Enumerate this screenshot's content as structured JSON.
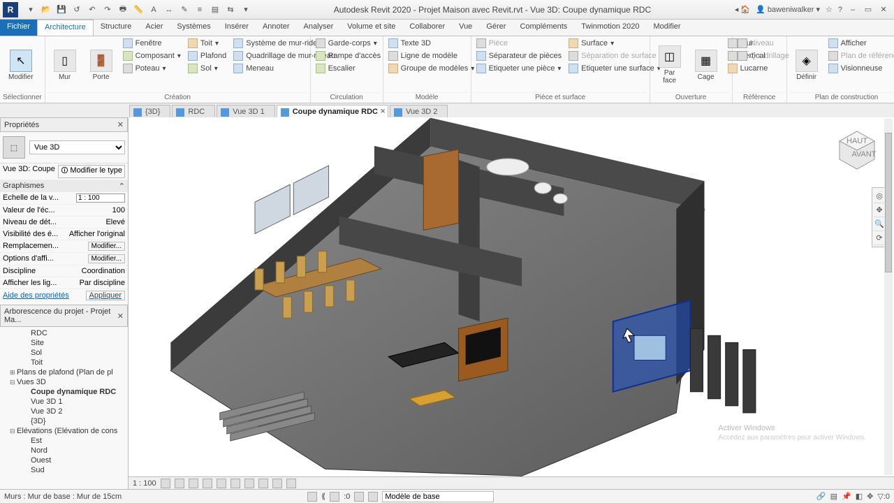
{
  "titlebar": {
    "app_title": "Autodesk Revit 2020 - Projet Maison avec Revit.rvt - Vue 3D: Coupe dynamique RDC",
    "user": "baweniwalker"
  },
  "menu": {
    "file": "Fichier",
    "tabs": [
      "Architecture",
      "Structure",
      "Acier",
      "Systèmes",
      "Insérer",
      "Annoter",
      "Analyser",
      "Volume et site",
      "Collaborer",
      "Vue",
      "Gérer",
      "Compléments",
      "Twinmotion 2020",
      "Modifier"
    ],
    "active": 0
  },
  "ribbon": {
    "modify": "Modifier",
    "select_label": "Sélectionner",
    "wall": "Mur",
    "door": "Porte",
    "window": "Fenêtre",
    "component": "Composant",
    "column": "Poteau",
    "roof": "Toit",
    "ceiling": "Plafond",
    "floor": "Sol",
    "curtain_system": "Système de mur-rideau",
    "curtain_grid": "Quadrillage de mur-rideau",
    "mullion": "Meneau",
    "create_label": "Création",
    "railing": "Garde-corps",
    "ramp": "Rampe d'accès",
    "stair": "Escalier",
    "circulation_label": "Circulation",
    "text3d": "Texte 3D",
    "model_line": "Ligne de modèle",
    "model_group": "Groupe de modèles",
    "model_label": "Modèle",
    "room": "Pièce",
    "room_sep": "Séparateur  de pièces",
    "room_tag": "Etiqueter  une pièce",
    "surface": "Surface",
    "surface_sep": "Séparation de surface",
    "surface_tag": "Etiqueter  une surface",
    "room_label": "Pièce et surface",
    "by_face": "Par face",
    "shaft": "Cage",
    "wall_op": "Mur",
    "vertical": "Vertical",
    "dormer": "Lucarne",
    "opening_label": "Ouverture",
    "level": "Niveau",
    "grid": "Quadrillage",
    "ref_label": "Référence",
    "define": "Définir",
    "show": "Afficher",
    "ref_plane": "Plan de référence",
    "viewer": "Visionneuse",
    "workplane_label": "Plan de construction"
  },
  "viewtabs": [
    {
      "label": "{3D}",
      "active": false
    },
    {
      "label": "RDC",
      "active": false
    },
    {
      "label": "Vue 3D 1",
      "active": false
    },
    {
      "label": "Coupe dynamique RDC",
      "active": true
    },
    {
      "label": "Vue 3D 2",
      "active": false
    }
  ],
  "properties": {
    "title": "Propriétés",
    "type": "Vue 3D",
    "instance": "Vue 3D: Coupe",
    "edit_type": "Modifier le type",
    "cat": "Graphismes",
    "rows": [
      {
        "k": "Echelle de la v...",
        "v": "1 : 100",
        "input": true
      },
      {
        "k": "Valeur de l'éc...",
        "v": "100"
      },
      {
        "k": "Niveau de dét...",
        "v": "Elevé"
      },
      {
        "k": "Visibilité des é...",
        "v": "Afficher l'original"
      },
      {
        "k": "Remplacemen...",
        "v": "Modifier...",
        "btn": true
      },
      {
        "k": "Options d'affi...",
        "v": "Modifier...",
        "btn": true
      },
      {
        "k": "Discipline",
        "v": "Coordination"
      },
      {
        "k": "Afficher les lig...",
        "v": "Par discipline"
      }
    ],
    "help": "Aide des propriétés",
    "apply": "Appliquer"
  },
  "browser": {
    "title": "Arborescence du projet - Projet Ma...",
    "items": [
      {
        "label": "RDC",
        "lvl": 2
      },
      {
        "label": "Site",
        "lvl": 2
      },
      {
        "label": "Sol",
        "lvl": 2
      },
      {
        "label": "Toit",
        "lvl": 2
      },
      {
        "label": "Plans de plafond (Plan de pl",
        "lvl": 1,
        "plus": true
      },
      {
        "label": "Vues 3D",
        "lvl": 1
      },
      {
        "label": "Coupe dynamique RDC",
        "lvl": 2,
        "bold": true
      },
      {
        "label": "Vue 3D 1",
        "lvl": 2
      },
      {
        "label": "Vue 3D 2",
        "lvl": 2
      },
      {
        "label": "{3D}",
        "lvl": 2
      },
      {
        "label": "Elévations (Elévation de cons",
        "lvl": 1
      },
      {
        "label": "Est",
        "lvl": 2
      },
      {
        "label": "Nord",
        "lvl": 2
      },
      {
        "label": "Ouest",
        "lvl": 2
      },
      {
        "label": "Sud",
        "lvl": 2
      }
    ]
  },
  "viewcontrol": {
    "scale": "1 : 100"
  },
  "status": {
    "left": "Murs : Mur de base : Mur de 15cm",
    "pagenum": "0",
    "combo": "Modèle de base"
  },
  "watermark": {
    "l1": "Activer Windows",
    "l2": "Accédez aux paramètres pour activer Windows."
  }
}
